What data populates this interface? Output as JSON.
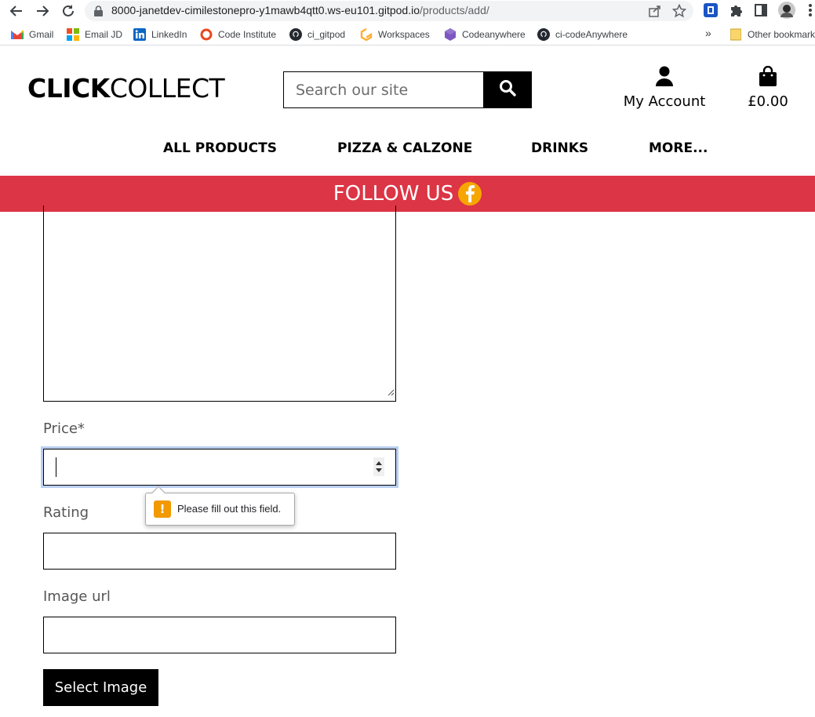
{
  "browser": {
    "url_main": "8000-janetdev-cimilestonepro-y1mawb4qtt0.ws-eu101.gitpod.io",
    "url_path": "/products/add/",
    "bookmarks": [
      {
        "label": "Gmail",
        "icon": "gmail-icon"
      },
      {
        "label": "Email JD",
        "icon": "microsoft-icon"
      },
      {
        "label": "LinkedIn",
        "icon": "linkedin-icon"
      },
      {
        "label": "Code Institute",
        "icon": "code-institute-icon"
      },
      {
        "label": "ci_gitpod",
        "icon": "github-icon"
      },
      {
        "label": "Workspaces",
        "icon": "gitpod-icon"
      },
      {
        "label": "Codeanywhere",
        "icon": "codeanywhere-icon"
      },
      {
        "label": "ci-codeAnywhere",
        "icon": "github-icon"
      }
    ],
    "overflow": "»",
    "other_bookmarks": "Other bookmarks"
  },
  "header": {
    "logo_bold": "CLICK",
    "logo_light": "COLLECT",
    "search_placeholder": "Search our site",
    "account_label": "My Account",
    "bag_total": "£0.00"
  },
  "nav": {
    "items": [
      "ALL PRODUCTS",
      "PIZZA & CALZONE",
      "DRINKS",
      "MORE..."
    ]
  },
  "banner": {
    "text": "FOLLOW US",
    "icon": "facebook-icon",
    "color": "#dc3545"
  },
  "form": {
    "price_label": "Price*",
    "price_value": "",
    "validation_message": "Please fill out this field.",
    "rating_label": "Rating",
    "rating_value": "",
    "image_url_label": "Image url",
    "image_url_value": "",
    "select_image_label": "Select Image"
  }
}
